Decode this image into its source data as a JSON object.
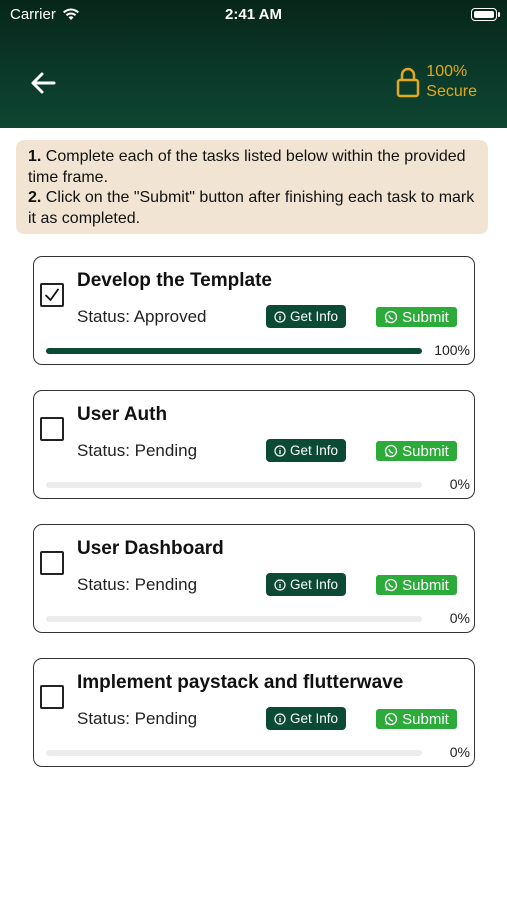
{
  "status_bar": {
    "carrier": "Carrier",
    "time": "2:41 AM"
  },
  "header": {
    "back_icon": "arrow-left-icon",
    "secure_line1": "100%",
    "secure_line2": "Secure",
    "accent_color": "#e2a91c"
  },
  "instructions": {
    "step1_number": "1.",
    "step1_text": " Complete each of the tasks listed below within the provided time frame.",
    "step2_number": "2.",
    "step2_text": " Click on the \"Submit\" button after finishing each task to mark it as completed."
  },
  "buttons": {
    "info_label": "Get Info",
    "submit_label": "Submit",
    "info_icon": "info-circle-icon",
    "submit_icon": "whatsapp-icon"
  },
  "tasks": [
    {
      "title": "Develop the Template",
      "status": "Status: Approved",
      "checked": true,
      "progress": 1.0,
      "progress_label": "100%"
    },
    {
      "title": "User Auth",
      "status": "Status: Pending",
      "checked": false,
      "progress": 0,
      "progress_label": "0%"
    },
    {
      "title": "User Dashboard",
      "status": "Status: Pending",
      "checked": false,
      "progress": 0,
      "progress_label": "0%"
    },
    {
      "title": "Implement paystack and flutterwave",
      "status": "Status: Pending",
      "checked": false,
      "progress": 0,
      "progress_label": "0%"
    }
  ]
}
